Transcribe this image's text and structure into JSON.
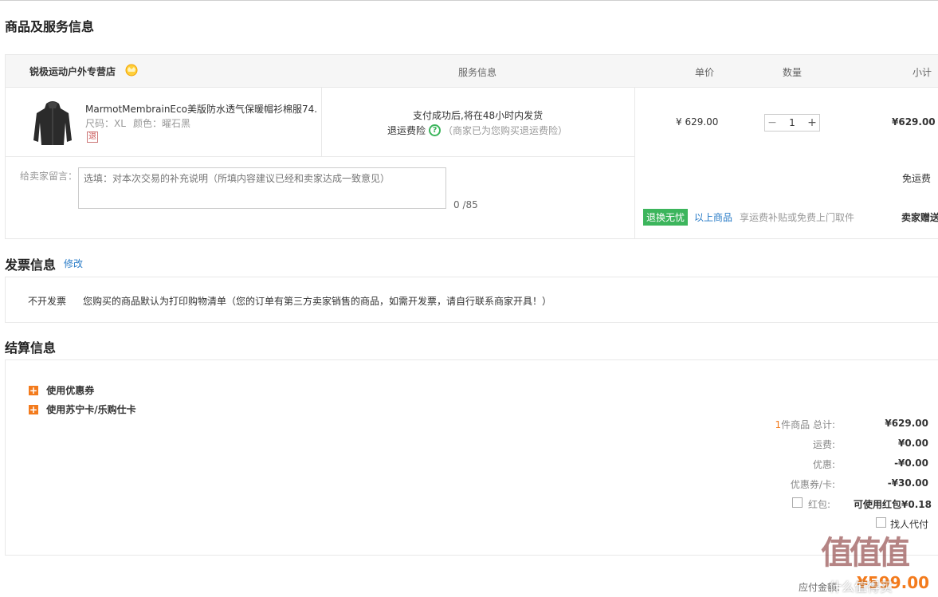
{
  "sections": {
    "goods_title": "商品及服务信息",
    "invoice_title": "发票信息",
    "invoice_edit": "修改",
    "settle_title": "结算信息"
  },
  "order": {
    "store_name": "锐极运动户外专营店",
    "headers": {
      "service": "服务信息",
      "unit_price": "单价",
      "quantity": "数量",
      "subtotal": "小计"
    },
    "item": {
      "name": "MarmotMembrainEco美版防水透气保暖帽衫棉服74...",
      "size": "尺码：XL",
      "color": "颜色：曜石黑",
      "return_tag": "退",
      "service_line1": "支付成功后,将在48小时内发货",
      "return_insurance": "退运费险",
      "return_note": "（商家已为您购买退运费险）",
      "unit_price": "¥ 629.00",
      "qty": "1",
      "qty_minus": "−",
      "qty_plus": "+",
      "subtotal": "¥629.00"
    },
    "remark_label": "给卖家留言：",
    "remark_placeholder": "选填：对本次交易的补充说明（所填内容建议已经和卖家达成一致意见）",
    "remark_count": "0 /85",
    "shipping_free": "免运费",
    "worry_free_badge": "退换无忧",
    "above_goods": "以上商品",
    "worry_free_desc": "享运费补贴或免费上门取件",
    "seller_gift": "卖家赠送"
  },
  "invoice": {
    "type": "不开发票",
    "desc": "您购买的商品默认为打印购物清单（您的订单有第三方卖家销售的商品，如需开发票，请自行联系商家开具！）"
  },
  "settlement": {
    "use_coupon": "使用优惠券",
    "use_card": "使用苏宁卡/乐购仕卡",
    "item_count": "1",
    "item_count_suffix": "件商品 总计:",
    "total": "¥629.00",
    "shipping_label": "运费:",
    "shipping": "¥0.00",
    "discount_label": "优惠:",
    "discount": "-¥0.00",
    "coupon_label": "优惠券/卡:",
    "coupon": "-¥30.00",
    "redpack_label": "红包:",
    "redpack": "可使用红包¥0.18",
    "proxy_pay": "找人代付",
    "payable_label": "应付金额:",
    "payable": "¥599.00"
  },
  "watermark": {
    "logo_text": "值值值",
    "site_text": "什么值得买"
  },
  "colors": {
    "accent_orange": "#f37b1d",
    "link_blue": "#2a7cc7",
    "green_badge": "#3cb55c",
    "price_red": "#e4393c"
  }
}
